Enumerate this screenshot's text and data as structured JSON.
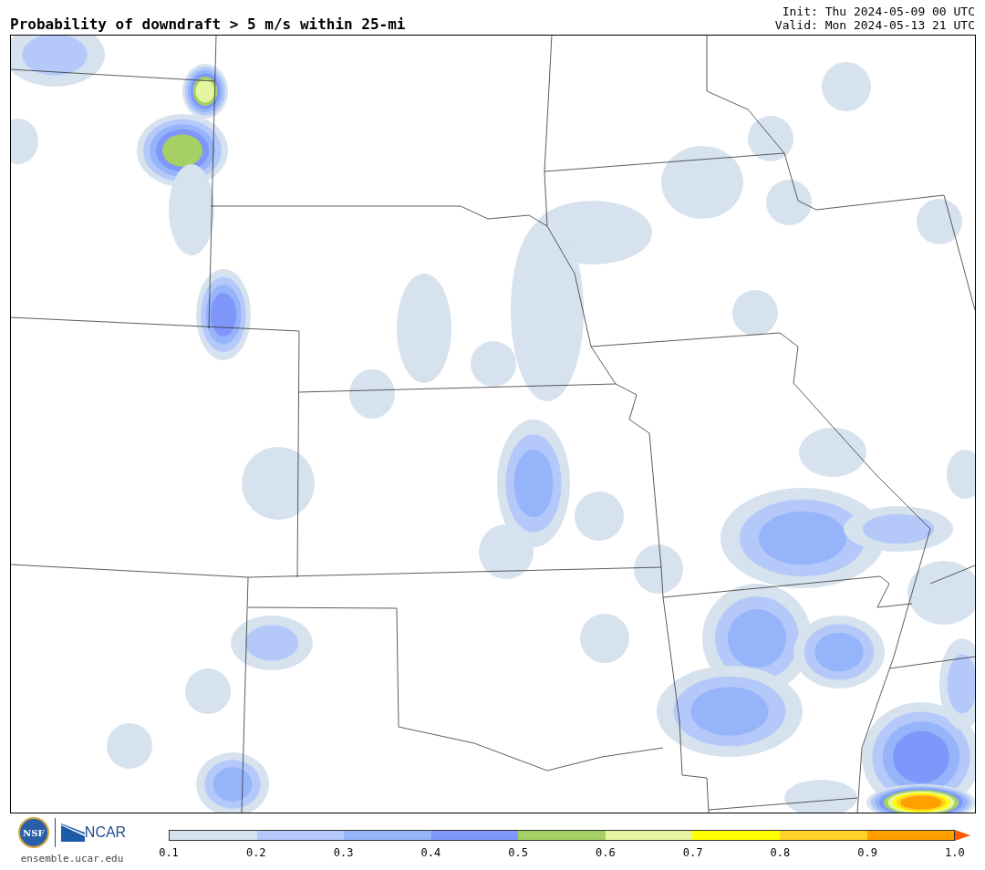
{
  "title": "Probability of downdraft > 5 m/s within 25-mi",
  "init": "Init: Thu 2024-05-09 00 UTC",
  "valid": "Valid: Mon 2024-05-13 21 UTC",
  "logo": {
    "nsf": "NSF",
    "ncar": "NCAR",
    "url": "ensemble.ucar.edu"
  },
  "colorbar": {
    "bins": [
      {
        "color": "#d6e2ee"
      },
      {
        "color": "#b4c8fa"
      },
      {
        "color": "#96b4fa"
      },
      {
        "color": "#7f96fa"
      },
      {
        "color": "#a6d064"
      },
      {
        "color": "#e6f5a0"
      },
      {
        "color": "#ffff00"
      },
      {
        "color": "#ffd228"
      },
      {
        "color": "#ffa000"
      }
    ],
    "overflow": {
      "color": "#ff5a00"
    },
    "labels": [
      "0.1",
      "0.2",
      "0.3",
      "0.4",
      "0.5",
      "0.6",
      "0.7",
      "0.8",
      "0.9",
      "1.0"
    ]
  }
}
